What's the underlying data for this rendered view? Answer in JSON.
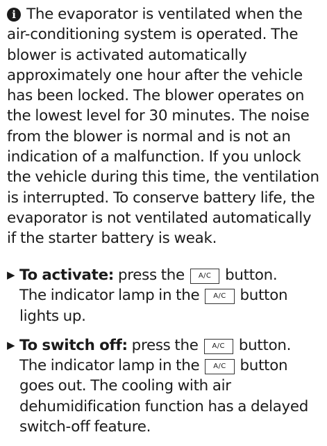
{
  "info": {
    "icon": "info-icon",
    "icon_glyph": "i",
    "text": "The evaporator is ventilated when the air-conditioning system is operated. The blower is activated automatically approximately one hour after the vehicle has been locked. The blower operates on the lowest level for 30 minutes. The noise from the blower is normal and is not an indication of a malfunction. If you unlock the vehicle during this time, the ventilation is interrupted. To conserve battery life, the evaporator is not ventilated automatically if the starter battery is weak."
  },
  "steps": [
    {
      "marker": "▶",
      "label": "To activate:",
      "text_1": "press the",
      "key_1": "A/C",
      "text_2": "button.",
      "text_3": "The indicator lamp in the",
      "key_2": "A/C",
      "text_4": "button lights up."
    },
    {
      "marker": "▶",
      "label": "To switch off:",
      "text_1": "press the",
      "key_1": "A/C",
      "text_2": "button.",
      "text_3": "The indicator lamp in the",
      "key_2": "A/C",
      "text_4": "button goes out. The cooling with air dehumidification function has a delayed switch-off feature."
    }
  ]
}
